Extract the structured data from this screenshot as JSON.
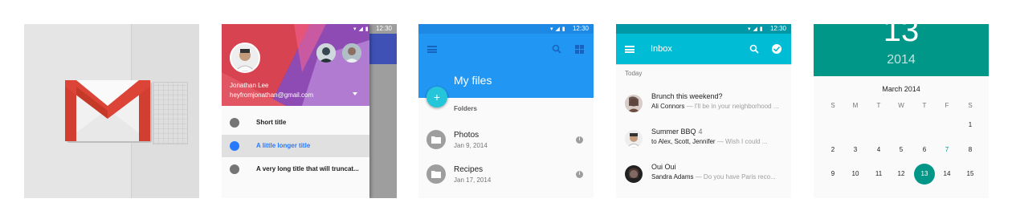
{
  "status_time": "12:30",
  "drawer": {
    "account_name": "Jonathan Lee",
    "account_email": "heyfromjonathan@gmail.com",
    "items": [
      {
        "label": "Short title"
      },
      {
        "label": "A little longer title"
      },
      {
        "label": "A very long title that will truncat..."
      }
    ]
  },
  "files": {
    "title": "My files",
    "fab_symbol": "+",
    "section": "Folders",
    "items": [
      {
        "name": "Photos",
        "date": "Jan 9, 2014"
      },
      {
        "name": "Recipes",
        "date": "Jan 17, 2014"
      }
    ],
    "info_symbol": "i"
  },
  "inbox": {
    "title": "Inbox",
    "section": "Today",
    "messages": [
      {
        "subject": "Brunch this weekend?",
        "count": "",
        "from": "Ali Connors",
        "preview": " — I'll be in your neighborhood ..."
      },
      {
        "subject": "Summer BBQ",
        "count": "4",
        "from": "to Alex, Scott, Jennifer",
        "preview": " — Wish I could ..."
      },
      {
        "subject": "Oui Oui",
        "count": "",
        "from": "Sandra Adams",
        "preview": " — Do you have Paris reco..."
      }
    ]
  },
  "datepicker": {
    "selected_day": "13",
    "year": "2014",
    "month": "March 2014",
    "weekdays": [
      "S",
      "M",
      "T",
      "W",
      "T",
      "F",
      "S"
    ],
    "days": [
      "1",
      "2",
      "3",
      "4",
      "5",
      "6",
      "7",
      "8",
      "9",
      "10",
      "11",
      "12",
      "13",
      "14",
      "15"
    ],
    "first_weekday_index": 6,
    "today_day": "7"
  },
  "colors": {
    "gmail_red": "#d23f31",
    "drawer_accent": "#2979ff",
    "files_blue": "#2196f3",
    "fab": "#26c6da",
    "inbox_cyan": "#00bcd4",
    "calendar_teal": "#009688"
  }
}
